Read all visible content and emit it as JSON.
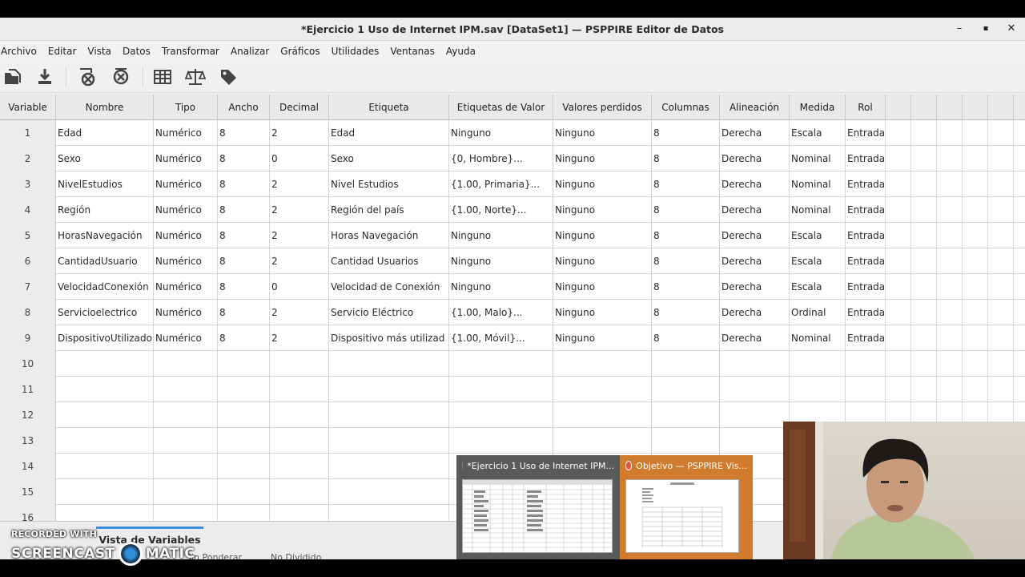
{
  "window": {
    "title": "*Ejercicio 1 Uso de Internet IPM.sav [DataSet1] — PSPPIRE Editor de Datos",
    "minimize": "–",
    "maximize": "▪",
    "close": "✕"
  },
  "menu": [
    "Archivo",
    "Editar",
    "Vista",
    "Datos",
    "Transformar",
    "Analizar",
    "Gráficos",
    "Utilidades",
    "Ventanas",
    "Ayuda"
  ],
  "toolbar": {
    "icons": [
      "open-file-icon",
      "save-icon",
      "delete-variable-icon",
      "delete-case-icon",
      "split-file-icon",
      "weight-cases-icon",
      "value-labels-icon"
    ]
  },
  "columns": [
    "Variable",
    "Nombre",
    "Tipo",
    "Ancho",
    "Decimal",
    "Etiqueta",
    "Etiquetas de Valor",
    "Valores perdidos",
    "Columnas",
    "Alineación",
    "Medida",
    "Rol"
  ],
  "rows": [
    {
      "n": "1",
      "nombre": "Edad",
      "tipo": "Numérico",
      "ancho": "8",
      "decimal": "2",
      "etiqueta": "Edad",
      "valores": "Ninguno",
      "perdidos": "Ninguno",
      "columnas": "8",
      "alineacion": "Derecha",
      "medida": "Escala",
      "rol": "Entrada"
    },
    {
      "n": "2",
      "nombre": "Sexo",
      "tipo": "Numérico",
      "ancho": "8",
      "decimal": "0",
      "etiqueta": "Sexo",
      "valores": "{0, Hombre}...",
      "perdidos": "Ninguno",
      "columnas": "8",
      "alineacion": "Derecha",
      "medida": "Nominal",
      "rol": "Entrada"
    },
    {
      "n": "3",
      "nombre": "NivelEstudios",
      "tipo": "Numérico",
      "ancho": "8",
      "decimal": "2",
      "etiqueta": "Nivel Estudios",
      "valores": "{1.00, Primaria}...",
      "perdidos": "Ninguno",
      "columnas": "8",
      "alineacion": "Derecha",
      "medida": "Nominal",
      "rol": "Entrada"
    },
    {
      "n": "4",
      "nombre": "Región",
      "tipo": "Numérico",
      "ancho": "8",
      "decimal": "2",
      "etiqueta": "Región del país",
      "valores": "{1.00, Norte}...",
      "perdidos": "Ninguno",
      "columnas": "8",
      "alineacion": "Derecha",
      "medida": "Nominal",
      "rol": "Entrada"
    },
    {
      "n": "5",
      "nombre": "HorasNavegación",
      "tipo": "Numérico",
      "ancho": "8",
      "decimal": "2",
      "etiqueta": "Horas Navegación",
      "valores": "Ninguno",
      "perdidos": "Ninguno",
      "columnas": "8",
      "alineacion": "Derecha",
      "medida": "Escala",
      "rol": "Entrada"
    },
    {
      "n": "6",
      "nombre": "CantidadUsuario",
      "tipo": "Numérico",
      "ancho": "8",
      "decimal": "2",
      "etiqueta": "Cantidad Usuarios",
      "valores": "Ninguno",
      "perdidos": "Ninguno",
      "columnas": "8",
      "alineacion": "Derecha",
      "medida": "Escala",
      "rol": "Entrada"
    },
    {
      "n": "7",
      "nombre": "VelocidadConexión",
      "tipo": "Numérico",
      "ancho": "8",
      "decimal": "0",
      "etiqueta": "Velocidad de Conexión",
      "valores": "Ninguno",
      "perdidos": "Ninguno",
      "columnas": "8",
      "alineacion": "Derecha",
      "medida": "Escala",
      "rol": "Entrada"
    },
    {
      "n": "8",
      "nombre": "Servicioelectrico",
      "tipo": "Numérico",
      "ancho": "8",
      "decimal": "2",
      "etiqueta": "Servicio Eléctrico",
      "valores": "{1.00, Malo}...",
      "perdidos": "Ninguno",
      "columnas": "8",
      "alineacion": "Derecha",
      "medida": "Ordinal",
      "rol": "Entrada"
    },
    {
      "n": "9",
      "nombre": "DispositivoUtilizado",
      "tipo": "Numérico",
      "ancho": "8",
      "decimal": "2",
      "etiqueta": "Dispositivo más utilizad",
      "valores": "{1.00, Móvil}...",
      "perdidos": "Ninguno",
      "columnas": "8",
      "alineacion": "Derecha",
      "medida": "Nominal",
      "rol": "Entrada"
    }
  ],
  "empty_rows": [
    "10",
    "11",
    "12",
    "13",
    "14",
    "15",
    "16"
  ],
  "tabs": {
    "active": "Vista de Variables"
  },
  "status": {
    "left": "Sin Ponderar",
    "right": "No Dividido"
  },
  "previews": [
    {
      "title": "*Ejercicio 1 Uso de Internet IPM..."
    },
    {
      "title": "Objetivo — PSPPIRE Vis..."
    }
  ],
  "watermark": {
    "line1": "RECORDED WITH",
    "line2a": "SCREENCAST",
    "line2b": "MATIC"
  }
}
